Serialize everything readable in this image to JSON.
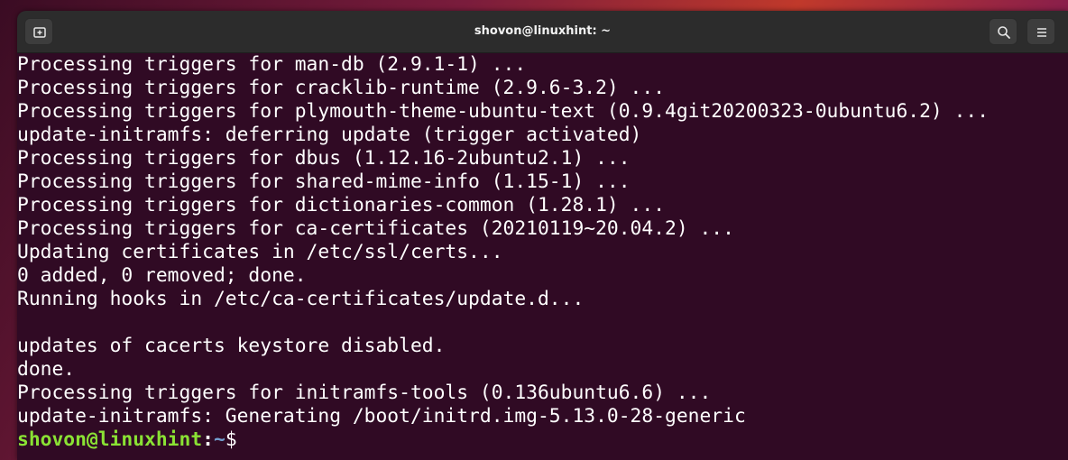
{
  "window": {
    "title": "shovon@linuxhint: ~"
  },
  "terminal": {
    "lines": [
      "Processing triggers for man-db (2.9.1-1) ...",
      "Processing triggers for cracklib-runtime (2.9.6-3.2) ...",
      "Processing triggers for plymouth-theme-ubuntu-text (0.9.4git20200323-0ubuntu6.2) ...",
      "update-initramfs: deferring update (trigger activated)",
      "Processing triggers for dbus (1.12.16-2ubuntu2.1) ...",
      "Processing triggers for shared-mime-info (1.15-1) ...",
      "Processing triggers for dictionaries-common (1.28.1) ...",
      "Processing triggers for ca-certificates (20210119~20.04.2) ...",
      "Updating certificates in /etc/ssl/certs...",
      "0 added, 0 removed; done.",
      "Running hooks in /etc/ca-certificates/update.d...",
      "",
      "updates of cacerts keystore disabled.",
      "done.",
      "Processing triggers for initramfs-tools (0.136ubuntu6.6) ...",
      "update-initramfs: Generating /boot/initrd.img-5.13.0-28-generic"
    ],
    "prompt": {
      "user_host": "shovon@linuxhint",
      "separator": ":",
      "path": "~",
      "symbol": "$"
    }
  },
  "icons": {
    "new_tab": "new-tab-icon",
    "search": "search-icon",
    "menu": "hamburger-menu-icon"
  },
  "colors": {
    "terminal_bg": "#300a24",
    "prompt_user": "#8ae234",
    "prompt_path": "#729fcf",
    "titlebar_bg": "#2c2c2c"
  }
}
